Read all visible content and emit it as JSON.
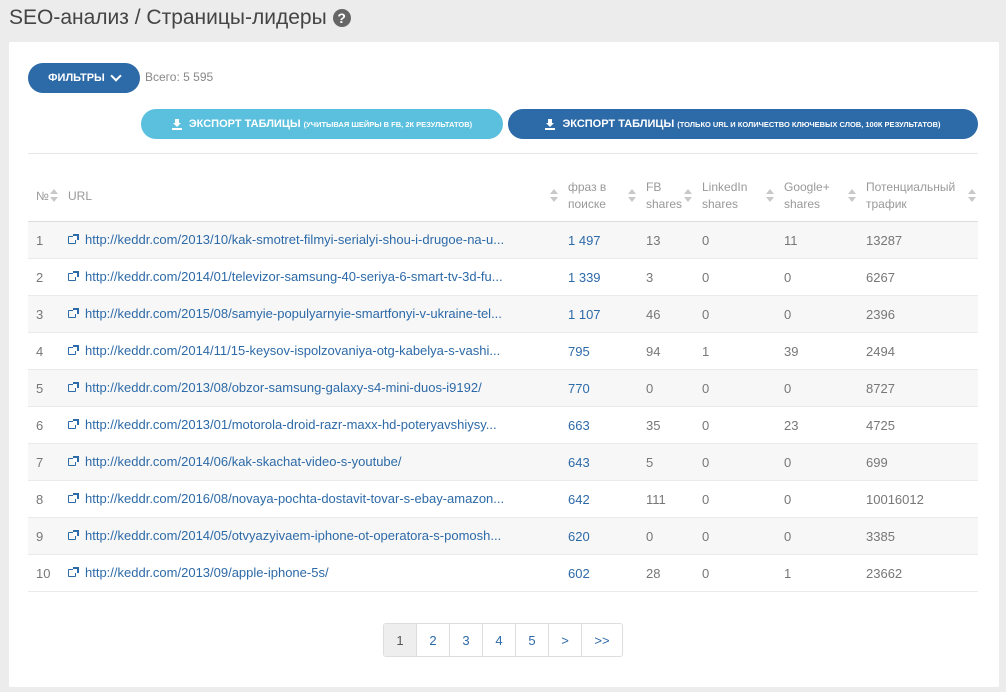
{
  "header": {
    "title": "SEO-анализ / Страницы-лидеры",
    "help_icon": "?"
  },
  "toolbar": {
    "filters_label": "ФИЛЬТРЫ",
    "total_label": "Всего: 5 595",
    "export1_label": "ЭКСПОРТ ТАБЛИЦЫ",
    "export1_note": "(УЧИТЫВАЯ ШЕЙРЫ В FB, 2К РЕЗУЛЬТАТОВ)",
    "export2_label": "ЭКСПОРТ ТАБЛИЦЫ",
    "export2_note": "(ТОЛЬКО URL И КОЛИЧЕСТВО КЛЮЧЕВЫХ СЛОВ, 100К РЕЗУЛЬТАТОВ)"
  },
  "table": {
    "columns": [
      "№",
      "URL",
      "фраз в поиске",
      "FB shares",
      "LinkedIn shares",
      "Google+ shares",
      "Потенциальный трафик"
    ],
    "rows": [
      {
        "n": "1",
        "url": "http://keddr.com/2013/10/kak-smotret-filmyi-serialyi-shou-i-drugoe-na-u...",
        "phrases": "1 497",
        "fb": "13",
        "li": "0",
        "gp": "11",
        "traffic": "13287"
      },
      {
        "n": "2",
        "url": "http://keddr.com/2014/01/televizor-samsung-40-seriya-6-smart-tv-3d-fu...",
        "phrases": "1 339",
        "fb": "3",
        "li": "0",
        "gp": "0",
        "traffic": "6267"
      },
      {
        "n": "3",
        "url": "http://keddr.com/2015/08/samyie-populyarnyie-smartfonyi-v-ukraine-tel...",
        "phrases": "1 107",
        "fb": "46",
        "li": "0",
        "gp": "0",
        "traffic": "2396"
      },
      {
        "n": "4",
        "url": "http://keddr.com/2014/11/15-keysov-ispolzovaniya-otg-kabelya-s-vashi...",
        "phrases": "795",
        "fb": "94",
        "li": "1",
        "gp": "39",
        "traffic": "2494"
      },
      {
        "n": "5",
        "url": "http://keddr.com/2013/08/obzor-samsung-galaxy-s4-mini-duos-i9192/",
        "phrases": "770",
        "fb": "0",
        "li": "0",
        "gp": "0",
        "traffic": "8727"
      },
      {
        "n": "6",
        "url": "http://keddr.com/2013/01/motorola-droid-razr-maxx-hd-poteryavshiysy...",
        "phrases": "663",
        "fb": "35",
        "li": "0",
        "gp": "23",
        "traffic": "4725"
      },
      {
        "n": "7",
        "url": "http://keddr.com/2014/06/kak-skachat-video-s-youtube/",
        "phrases": "643",
        "fb": "5",
        "li": "0",
        "gp": "0",
        "traffic": "699"
      },
      {
        "n": "8",
        "url": "http://keddr.com/2016/08/novaya-pochta-dostavit-tovar-s-ebay-amazon...",
        "phrases": "642",
        "fb": "111",
        "li": "0",
        "gp": "0",
        "traffic": "10016012"
      },
      {
        "n": "9",
        "url": "http://keddr.com/2014/05/otvyazyivaem-iphone-ot-operatora-s-pomosh...",
        "phrases": "620",
        "fb": "0",
        "li": "0",
        "gp": "0",
        "traffic": "3385"
      },
      {
        "n": "10",
        "url": "http://keddr.com/2013/09/apple-iphone-5s/",
        "phrases": "602",
        "fb": "28",
        "li": "0",
        "gp": "1",
        "traffic": "23662"
      }
    ]
  },
  "pagination": {
    "pages": [
      "1",
      "2",
      "3",
      "4",
      "5",
      ">",
      ">>"
    ],
    "active": "1"
  }
}
